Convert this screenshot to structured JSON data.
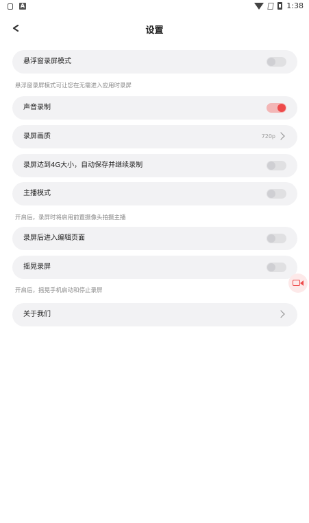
{
  "status_bar": {
    "time": "1:38",
    "left_icon_2": "A"
  },
  "header": {
    "title": "设置"
  },
  "settings": {
    "floating_mode": {
      "label": "悬浮窗录屏模式",
      "enabled": false
    },
    "floating_mode_hint": "悬浮窗录屏模式可让您在无需进入应用时录屏",
    "audio_record": {
      "label": "声音录制",
      "enabled": true
    },
    "quality": {
      "label": "录屏画质",
      "value": "720p"
    },
    "auto_save_4g": {
      "label": "录屏达到4G大小，自动保存并继续录制",
      "enabled": false
    },
    "streamer_mode": {
      "label": "主播模式",
      "enabled": false
    },
    "streamer_mode_hint": "开启后，录屏时将启用前置摄像头拍摄主播",
    "open_editor": {
      "label": "录屏后进入编辑页面",
      "enabled": false
    },
    "shake_record": {
      "label": "摇晃录屏",
      "enabled": false
    },
    "shake_record_hint": "开启后，摇晃手机启动和停止录屏",
    "about": {
      "label": "关于我们"
    }
  },
  "colors": {
    "accent": "#ee4a4a",
    "card_bg": "#f2f2f4"
  },
  "icons": [
    "lock-icon",
    "a-icon",
    "wifi-icon",
    "sim-icon",
    "battery-icon",
    "back-arrow-icon",
    "chevron-right-icon",
    "video-camera-icon"
  ]
}
